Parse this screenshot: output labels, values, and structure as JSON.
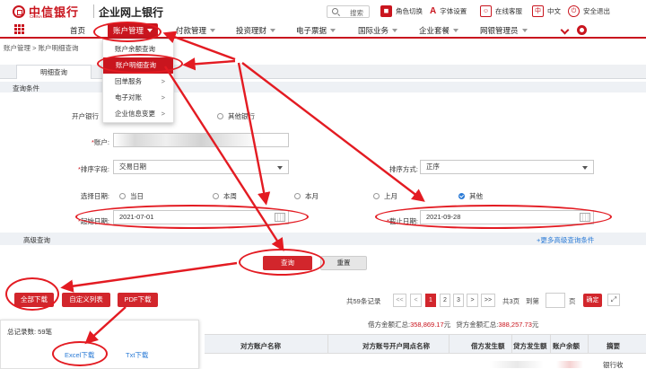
{
  "header": {
    "brand_cn": "中信银行",
    "brand_en": "CHINA CITIC BANK",
    "app_title": "企业网上银行",
    "search_placeholder": "搜索",
    "tools": [
      {
        "label": "角色切换",
        "icon": "role-switch-icon"
      },
      {
        "label": "字体设置",
        "icon": "font-setting-icon"
      },
      {
        "label": "在线客服",
        "icon": "customer-service-icon"
      },
      {
        "label": "中文",
        "icon": "language-icon"
      },
      {
        "label": "安全退出",
        "icon": "logout-icon"
      }
    ],
    "accent_color": "#c9151e"
  },
  "nav": {
    "items": [
      {
        "label": "首页"
      },
      {
        "label": "账户管理",
        "active": true
      },
      {
        "label": "付款管理"
      },
      {
        "label": "投资理财"
      },
      {
        "label": "电子票据"
      },
      {
        "label": "国际业务"
      },
      {
        "label": "企业套餐"
      },
      {
        "label": "网银管理员"
      }
    ]
  },
  "dropdown": {
    "items": [
      {
        "label": "账户余额查询",
        "submenu": false
      },
      {
        "label": "账户明细查询",
        "submenu": false,
        "selected": true
      },
      {
        "label": "回单服务",
        "submenu": true
      },
      {
        "label": "电子对账",
        "submenu": true
      },
      {
        "label": "企业信息变更",
        "submenu": true
      }
    ],
    "submenu_marker": ">"
  },
  "breadcrumb": "账户管理 > 账户明细查询",
  "tab": "明细查询",
  "query": {
    "section_title": "查询条件",
    "bank_label": "开户银行",
    "bank_other": "其他银行",
    "account_label": "账户",
    "account_value": "",
    "sort_label": "排序字段",
    "sort_value": "交易日期",
    "order_label": "排序方式",
    "order_value": "正序",
    "date_choice_label": "选择日期",
    "date_options": [
      "当日",
      "本周",
      "本月",
      "上月",
      "其他"
    ],
    "date_selected": "其他",
    "start_label": "起始日期",
    "start_value": "2021-07-01",
    "end_label": "截止日期",
    "end_value": "2021-09-28",
    "required_mark": "*",
    "colon": ":"
  },
  "advanced": {
    "label": "高级查询",
    "more_link": "+更多高级查询条件"
  },
  "actions": {
    "query": "查询",
    "reset": "重置",
    "download_all": "全部下载",
    "custom_list": "自定义列表",
    "pdf_download": "PDF下载"
  },
  "pagination": {
    "total_records": "共59条记录",
    "first": "<<",
    "prev": "<",
    "pages": [
      "1",
      "2",
      "3"
    ],
    "current_page": "1",
    "next": ">",
    "last": ">>",
    "total_pages": "共3页",
    "goto_label": "到第",
    "goto_suffix": "页",
    "confirm": "确定",
    "expand_icon": "expand-icon"
  },
  "summary": {
    "debit_label": "借方金额汇总:",
    "debit_value": "358,869.17",
    "credit_label": "贷方金额汇总:",
    "credit_value": "388,257.73",
    "unit": "元",
    "total_count": "总记录数: 59笔"
  },
  "download_popup": {
    "excel": "Excel下载",
    "txt": "Txt下载"
  },
  "table": {
    "headers": [
      "对方账户名称",
      "对方账号开户网点名称",
      "借方发生额",
      "贷方发生额",
      "账户余额",
      "摘要"
    ],
    "first_row_summary": "银行收"
  }
}
